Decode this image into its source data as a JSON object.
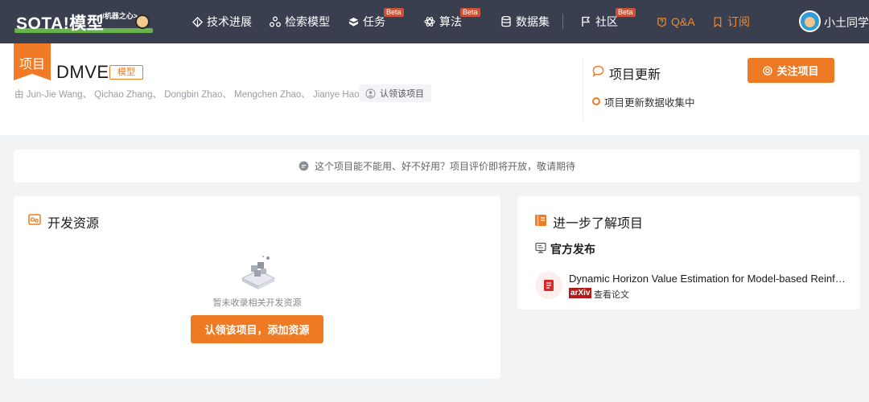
{
  "nav": {
    "logo_text": "SOTA!模型",
    "logo_sub": "</机器之心>",
    "items": [
      {
        "label": "技术进展",
        "icon": "layers-icon"
      },
      {
        "label": "检索模型",
        "icon": "nodes-icon"
      },
      {
        "label": "任务",
        "icon": "cube-icon",
        "badge": "Beta"
      },
      {
        "label": "算法",
        "icon": "atom-icon",
        "badge": "Beta"
      },
      {
        "label": "数据集",
        "icon": "database-icon"
      },
      {
        "label": "社区",
        "icon": "flag-icon",
        "badge": "Beta"
      },
      {
        "label": "Q&A",
        "icon": "qa-icon"
      },
      {
        "label": "订阅",
        "icon": "bookmark-icon"
      }
    ],
    "username": "小土同学",
    "accent": "#f28a2b"
  },
  "project": {
    "ribbon": "项目",
    "name": "DMVE",
    "tag": "模型",
    "authors": "由 Jun-Jie Wang、 Qichao Zhang、 Dongbin Zhao、 Mengchen Zhao、 Jianye Hao 研发",
    "claim_label": "认领该项目"
  },
  "updates": {
    "title": "项目更新",
    "follow_label": "关注项目",
    "status": "项目更新数据收集中"
  },
  "notice": "这个项目能不能用、好不好用？项目评价即将开放，敬请期待",
  "dev_resources": {
    "title": "开发资源",
    "empty_text": "暂未收录相关开发资源",
    "button_label": "认领该项目，添加资源"
  },
  "learn_more": {
    "title": "进一步了解项目",
    "section_title": "官方发布",
    "paper_title": "Dynamic Horizon Value Estimation for Model-based Reinforcement Learning",
    "source_badge": "arXiv",
    "paper_link": "查看论文"
  },
  "colors": {
    "nav_bg": "#3a3f4f",
    "brand_orange": "#ee7b24",
    "arxiv_red": "#b31b1b"
  }
}
